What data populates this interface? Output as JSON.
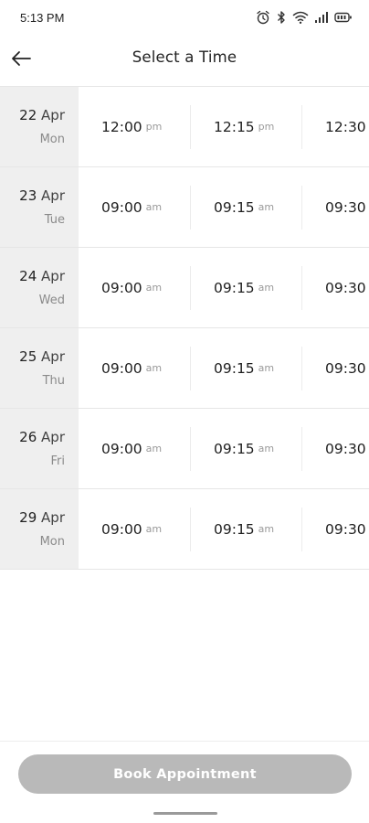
{
  "status_bar": {
    "time": "5:13 PM",
    "icons": [
      "alarm-icon",
      "bluetooth-icon",
      "wifi-icon",
      "signal-icon",
      "battery-icon"
    ]
  },
  "header": {
    "back_icon": "arrow-left-icon",
    "title": "Select a Time"
  },
  "schedule": {
    "days": [
      {
        "day": "22",
        "month": "Apr",
        "weekday": "Mon",
        "slots": [
          {
            "time": "12:00",
            "period": "pm"
          },
          {
            "time": "12:15",
            "period": "pm"
          },
          {
            "time": "12:30",
            "period": ""
          }
        ]
      },
      {
        "day": "23",
        "month": "Apr",
        "weekday": "Tue",
        "slots": [
          {
            "time": "09:00",
            "period": "am"
          },
          {
            "time": "09:15",
            "period": "am"
          },
          {
            "time": "09:30",
            "period": ""
          }
        ]
      },
      {
        "day": "24",
        "month": "Apr",
        "weekday": "Wed",
        "slots": [
          {
            "time": "09:00",
            "period": "am"
          },
          {
            "time": "09:15",
            "period": "am"
          },
          {
            "time": "09:30",
            "period": ""
          }
        ]
      },
      {
        "day": "25",
        "month": "Apr",
        "weekday": "Thu",
        "slots": [
          {
            "time": "09:00",
            "period": "am"
          },
          {
            "time": "09:15",
            "period": "am"
          },
          {
            "time": "09:30",
            "period": ""
          }
        ]
      },
      {
        "day": "26",
        "month": "Apr",
        "weekday": "Fri",
        "slots": [
          {
            "time": "09:00",
            "period": "am"
          },
          {
            "time": "09:15",
            "period": "am"
          },
          {
            "time": "09:30",
            "period": ""
          }
        ]
      },
      {
        "day": "29",
        "month": "Apr",
        "weekday": "Mon",
        "slots": [
          {
            "time": "09:00",
            "period": "am"
          },
          {
            "time": "09:15",
            "period": "am"
          },
          {
            "time": "09:30",
            "period": ""
          }
        ]
      }
    ]
  },
  "footer": {
    "book_button_label": "Book Appointment",
    "book_button_color": "#b9b9b9",
    "book_button_enabled": false
  },
  "colors": {
    "date_column_bg": "#efefef",
    "divider": "#e6e6e6",
    "period_text": "#9a9a9a",
    "weekday_text": "#8a8a8a"
  }
}
